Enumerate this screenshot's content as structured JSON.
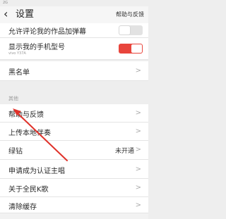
{
  "statusbar": {
    "left": "2G",
    "right": ""
  },
  "header": {
    "back_icon": "‹",
    "title": "设置",
    "right_link": "帮助与反馈"
  },
  "settings": {
    "row_comment_popup": {
      "label": "允许评论我的作品加弹幕",
      "toggle": "off"
    },
    "row_show_model": {
      "label": "显示我的手机型号",
      "subtext": "vivo Y37A",
      "toggle": "on"
    },
    "row_blacklist": {
      "label": "黑名单"
    }
  },
  "section_other": {
    "title": "其他",
    "rows": [
      {
        "label": "帮助与反馈",
        "value": ""
      },
      {
        "label": "上传本地伴奏",
        "value": ""
      },
      {
        "label": "绿钻",
        "value": "未开通"
      },
      {
        "label": "申请成为认证主唱",
        "value": ""
      },
      {
        "label": "关于全民K歌",
        "value": ""
      },
      {
        "label": "清除缓存",
        "value": ""
      }
    ]
  },
  "colors": {
    "toggle_on": "#e8453c",
    "annotation_arrow": "#e0322a"
  },
  "chevron": ">"
}
